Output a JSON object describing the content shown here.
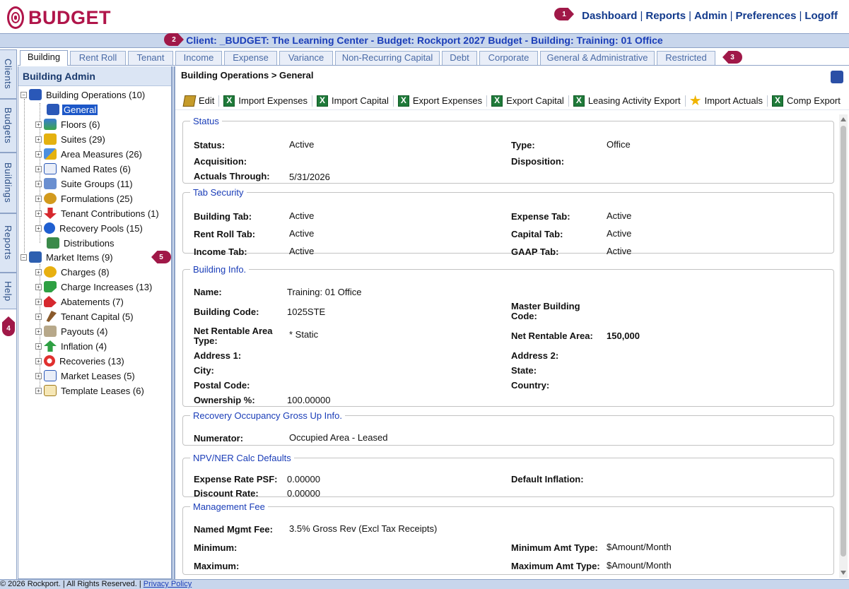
{
  "logo_text": "BUDGET",
  "topnav": {
    "dashboard": "Dashboard",
    "reports": "Reports",
    "admin": "Admin",
    "preferences": "Preferences",
    "logoff": "Logoff",
    "sep": "|"
  },
  "callouts": {
    "c1": "1",
    "c2": "2",
    "c3": "3",
    "c4": "4",
    "c5": "5"
  },
  "client_bar": "Client: _BUDGET: The Learning Center - Budget: Rockport 2027 Budget - Building: Training: 01 Office",
  "vtabs": [
    "Clients",
    "Budgets",
    "Buildings",
    "Reports",
    "Help"
  ],
  "tabs": [
    "Building",
    "Rent Roll",
    "Tenant",
    "Income",
    "Expense",
    "Variance",
    "Non-Recurring Capital",
    "Debt",
    "Corporate",
    "General & Administrative",
    "Restricted"
  ],
  "left_panel": {
    "title": "Building Admin",
    "root1": "Building Operations (10)",
    "root1_items": [
      "General",
      "Floors (6)",
      "Suites (29)",
      "Area Measures (26)",
      "Named Rates (6)",
      "Suite Groups (11)",
      "Formulations (25)",
      "Tenant Contributions (1)",
      "Recovery Pools (15)",
      "Distributions"
    ],
    "root2": "Market Items (9)",
    "root2_items": [
      "Charges (8)",
      "Charge Increases (13)",
      "Abatements (7)",
      "Tenant Capital (5)",
      "Payouts (4)",
      "Inflation (4)",
      "Recoveries (13)",
      "Market Leases (5)",
      "Template Leases (6)"
    ]
  },
  "icon_names": [
    "building-icon",
    "floors-icon",
    "suites-icon",
    "area-icon",
    "rates-icon",
    "groups-icon",
    "formulations-icon",
    "contributions-icon",
    "pools-icon",
    "distributions-icon"
  ],
  "main": {
    "breadcrumb": "Building Operations > General",
    "toolbar": [
      "Edit",
      "Import Expenses",
      "Import Capital",
      "Export Expenses",
      "Export Capital",
      "Leasing Activity Export",
      "Import Actuals",
      "Comp Export"
    ],
    "status": {
      "legend": "Status",
      "status_label": "Status:",
      "status_value": "Active",
      "type_label": "Type:",
      "type_value": "Office",
      "acq_label": "Acquisition:",
      "disp_label": "Disposition:",
      "actuals_label": "Actuals Through:",
      "actuals_value": "5/31/2026"
    },
    "tab_security": {
      "legend": "Tab Security",
      "building_label": "Building Tab:",
      "building_value": "Active",
      "expense_label": "Expense Tab:",
      "expense_value": "Active",
      "rentroll_label": "Rent Roll Tab:",
      "rentroll_value": "Active",
      "capital_label": "Capital Tab:",
      "capital_value": "Active",
      "income_label": "Income Tab:",
      "income_value": "Active",
      "gaap_label": "GAAP Tab:",
      "gaap_value": "Active"
    },
    "building_info": {
      "legend": "Building Info.",
      "name_label": "Name:",
      "name_value": "Training: 01 Office",
      "code_label": "Building Code:",
      "code_value": "1025STE",
      "master_label": "Master Building Code:",
      "nra_type_label": "Net Rentable Area Type:",
      "nra_type_value": "* Static",
      "nra_label": "Net Rentable Area:",
      "nra_value": "150,000",
      "addr1_label": "Address 1:",
      "addr2_label": "Address 2:",
      "city_label": "City:",
      "state_label": "State:",
      "postal_label": "Postal Code:",
      "country_label": "Country:",
      "ownership_label": "Ownership %:",
      "ownership_value": "100.00000"
    },
    "recovery": {
      "legend": "Recovery Occupancy Gross Up Info.",
      "numerator_label": "Numerator:",
      "numerator_value": "Occupied Area - Leased"
    },
    "npv": {
      "legend": "NPV/NER Calc Defaults",
      "exp_rate_label": "Expense Rate PSF:",
      "exp_rate_value": "0.00000",
      "inflation_label": "Default Inflation:",
      "discount_label": "Discount Rate:",
      "discount_value": "0.00000"
    },
    "mgmt_fee": {
      "legend": "Management Fee",
      "named_label": "Named Mgmt Fee:",
      "named_value": "3.5% Gross Rev (Excl Tax Receipts)",
      "min_label": "Minimum:",
      "min_type_label": "Minimum Amt Type:",
      "min_type_value": "$Amount/Month",
      "max_label": "Maximum:",
      "max_type_label": "Maximum Amt Type:",
      "max_type_value": "$Amount/Month"
    }
  },
  "footer": {
    "copyright": "© 2026 Rockport. | All Rights Reserved. |",
    "privacy": "Privacy Policy"
  },
  "colors": {
    "brand": "#b0154a",
    "link": "#123a8c",
    "accent_bar": "#c8d6ec",
    "selected": "#1c57c8"
  }
}
